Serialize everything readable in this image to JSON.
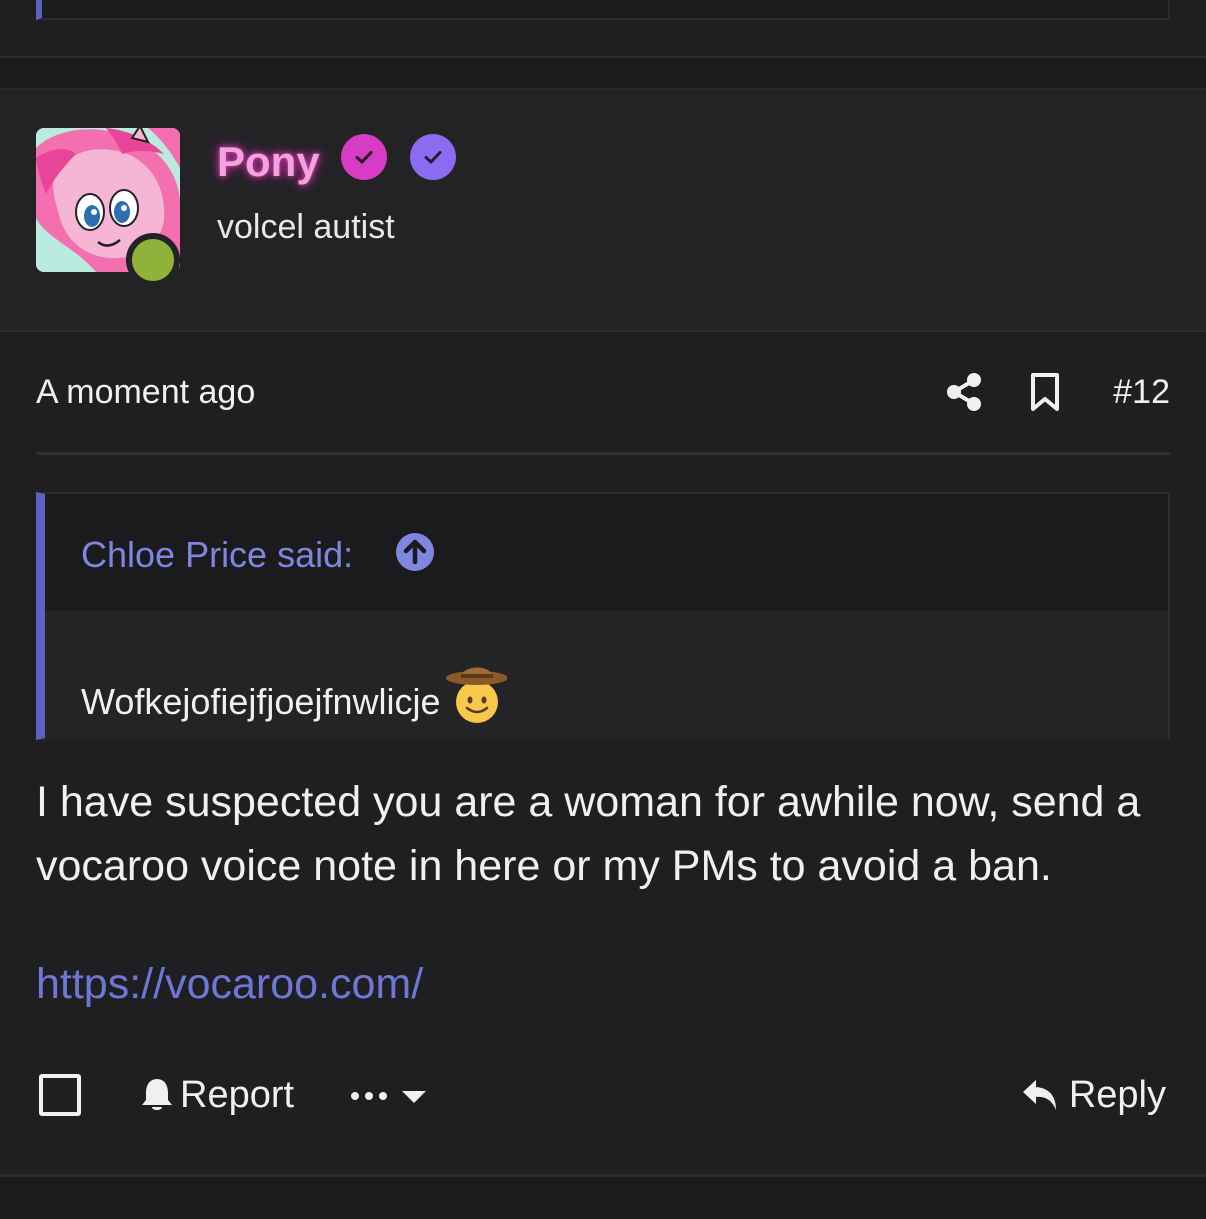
{
  "previous_post": {},
  "author": {
    "username": "Pony",
    "user_title": "volcel autist",
    "status": "online",
    "badges": [
      "verified-pink-badge-icon",
      "verified-purple-badge-icon"
    ],
    "username_color": "#f2a3dc"
  },
  "post": {
    "timestamp": "A moment ago",
    "post_number": "#12",
    "quote": {
      "author_label": "Chloe Price said:",
      "text": "Wofkejofiejfjoejfnwlicje",
      "emoji": "cowboy-face"
    },
    "body": "I have suspected you are a woman for awhile now, send a vocaroo voice note in here or my PMs to avoid a ban.",
    "link": "https://vocaroo.com/"
  },
  "actions": {
    "report_label": "Report",
    "reply_label": "Reply"
  },
  "colors": {
    "accent": "#5b62c4",
    "link": "#6e76d6",
    "online": "#8fb33a",
    "badge_pink": "#d63cc4",
    "badge_purple": "#8a6bf2"
  }
}
